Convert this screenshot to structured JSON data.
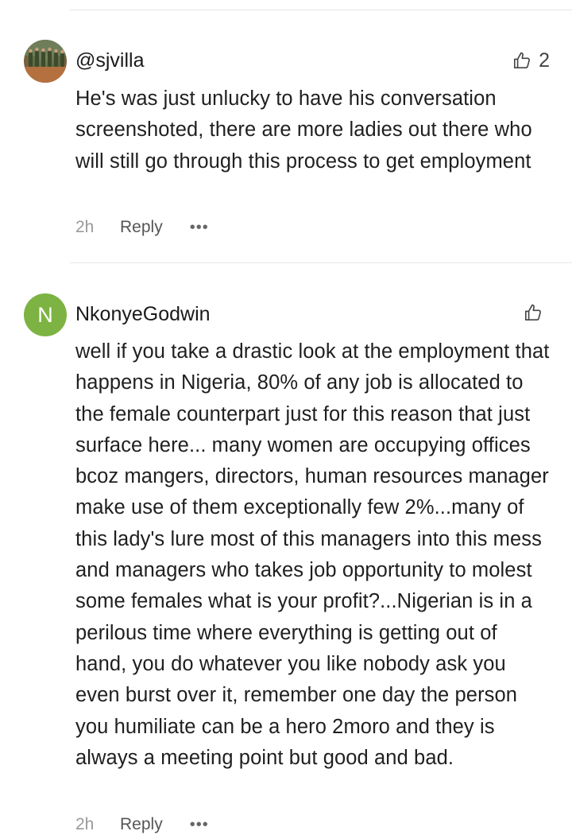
{
  "comments": [
    {
      "username": "@sjvilla",
      "avatar": {
        "type": "photo",
        "icon": "user-photo-avatar"
      },
      "likes": "2",
      "text": "He's was just unlucky to have his conversation screenshoted, there are more ladies out there who will still go through this process to get employment",
      "time": "2h",
      "reply_label": "Reply",
      "more_label": "•••"
    },
    {
      "username": "NkonyeGodwin",
      "avatar": {
        "type": "letter",
        "letter": "N",
        "color": "#7cb342"
      },
      "likes": "",
      "text": "well if you take a drastic look at the employment that happens in Nigeria, 80% of any job is allocated to the female counterpart just for this reason that just surface here... many women are occupying offices bcoz mangers, directors, human resources manager make use of them exceptionally few 2%...many of this lady's lure most of this managers into this mess and managers who takes job opportunity to molest some females what is your profit?...Nigerian is in a perilous time where everything is getting out of hand, you do whatever you like nobody ask you even burst over it, remember one day the person you humiliate can be a hero 2moro and they is always a meeting point but good and bad.",
      "time": "2h",
      "reply_label": "Reply",
      "more_label": "•••"
    }
  ]
}
